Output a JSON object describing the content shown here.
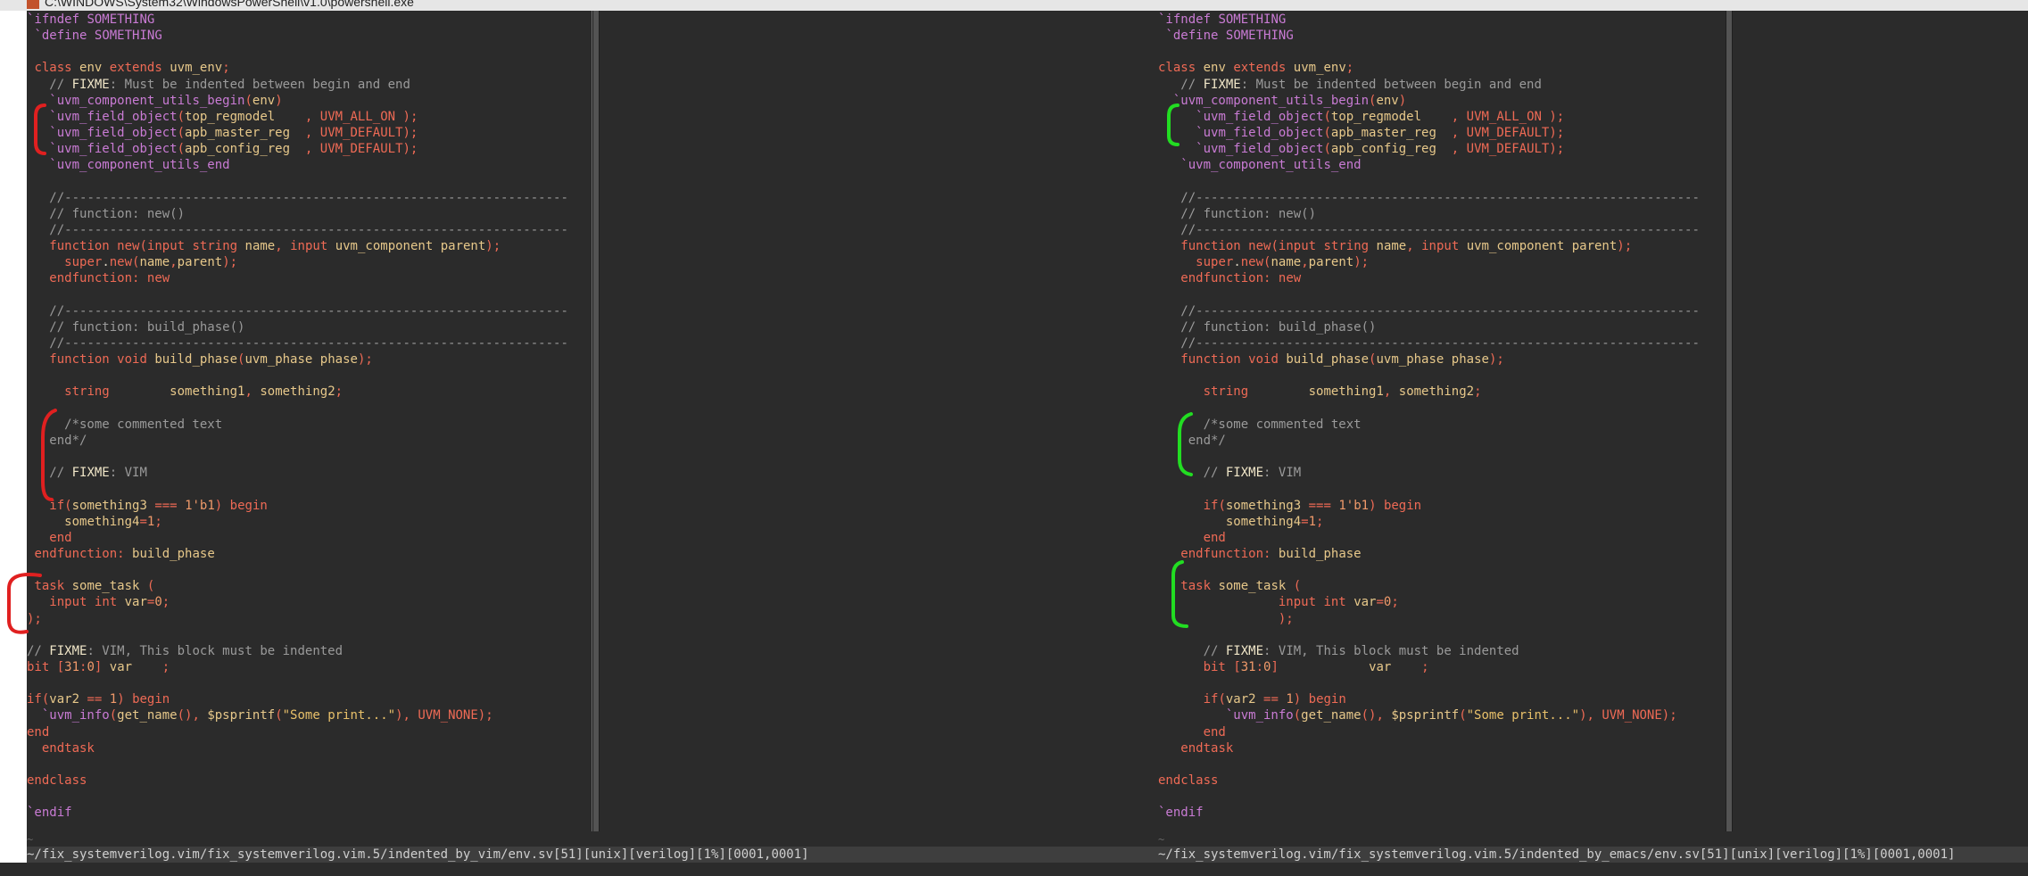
{
  "window": {
    "title": "C:\\WINDOWS\\System32\\WindowsPowerShell\\v1.0\\powershell.exe"
  },
  "colors": {
    "background": "#2b2b2b",
    "status_bar": "#3e3e3e",
    "keyword": "#ee6a55",
    "preprocessor": "#c97bd4",
    "comment": "#9a9a9a",
    "string": "#e8c06a",
    "bracket_left": "#e02020",
    "bracket_right": "#22dd22"
  },
  "left_pane": {
    "status": "~/fix_systemverilog.vim/fix_systemverilog.vim.5/indented_by_vim/env.sv[51][unix][verilog][1%][0001,0001]",
    "lines": [
      {
        "i": 0,
        "t": "`ifndef SOMETHING"
      },
      {
        "i": 1,
        "t": " `define SOMETHING"
      },
      {
        "i": 2,
        "t": ""
      },
      {
        "i": 3,
        "t": " class env extends uvm_env;"
      },
      {
        "i": 4,
        "t": "   // FIXME: Must be indented between begin and end"
      },
      {
        "i": 5,
        "t": "   `uvm_component_utils_begin(env)"
      },
      {
        "i": 6,
        "t": "   `uvm_field_object(top_regmodel    , UVM_ALL_ON );"
      },
      {
        "i": 7,
        "t": "   `uvm_field_object(apb_master_reg  , UVM_DEFAULT);"
      },
      {
        "i": 8,
        "t": "   `uvm_field_object(apb_config_reg  , UVM_DEFAULT);"
      },
      {
        "i": 9,
        "t": "   `uvm_component_utils_end"
      },
      {
        "i": 10,
        "t": ""
      },
      {
        "i": 11,
        "t": "   //-------------------------------------------------------------------"
      },
      {
        "i": 12,
        "t": "   // function: new()"
      },
      {
        "i": 13,
        "t": "   //-------------------------------------------------------------------"
      },
      {
        "i": 14,
        "t": "   function new(input string name, input uvm_component parent);"
      },
      {
        "i": 15,
        "t": "     super.new(name,parent);"
      },
      {
        "i": 16,
        "t": "   endfunction: new"
      },
      {
        "i": 17,
        "t": ""
      },
      {
        "i": 18,
        "t": "   //-------------------------------------------------------------------"
      },
      {
        "i": 19,
        "t": "   // function: build_phase()"
      },
      {
        "i": 20,
        "t": "   //-------------------------------------------------------------------"
      },
      {
        "i": 21,
        "t": "   function void build_phase(uvm_phase phase);"
      },
      {
        "i": 22,
        "t": ""
      },
      {
        "i": 23,
        "t": "     string        something1, something2;"
      },
      {
        "i": 24,
        "t": ""
      },
      {
        "i": 25,
        "t": "     /*some commented text"
      },
      {
        "i": 26,
        "t": "   end*/"
      },
      {
        "i": 27,
        "t": ""
      },
      {
        "i": 28,
        "t": "   // FIXME: VIM"
      },
      {
        "i": 29,
        "t": ""
      },
      {
        "i": 30,
        "t": "   if(something3 === 1'b1) begin"
      },
      {
        "i": 31,
        "t": "     something4=1;"
      },
      {
        "i": 32,
        "t": "   end"
      },
      {
        "i": 33,
        "t": " endfunction: build_phase"
      },
      {
        "i": 34,
        "t": ""
      },
      {
        "i": 35,
        "t": " task some_task ("
      },
      {
        "i": 36,
        "t": "   input int var=0;"
      },
      {
        "i": 37,
        "t": ");"
      },
      {
        "i": 38,
        "t": ""
      },
      {
        "i": 39,
        "t": "// FIXME: VIM, This block must be indented"
      },
      {
        "i": 40,
        "t": "bit [31:0] var    ;"
      },
      {
        "i": 41,
        "t": ""
      },
      {
        "i": 42,
        "t": "if(var2 == 1) begin"
      },
      {
        "i": 43,
        "t": "  `uvm_info(get_name(), $psprintf(\"Some print...\"), UVM_NONE);"
      },
      {
        "i": 44,
        "t": "end"
      },
      {
        "i": 45,
        "t": "  endtask"
      },
      {
        "i": 46,
        "t": ""
      },
      {
        "i": 47,
        "t": "endclass"
      },
      {
        "i": 48,
        "t": ""
      },
      {
        "i": 49,
        "t": "`endif"
      }
    ]
  },
  "right_pane": {
    "status": "~/fix_systemverilog.vim/fix_systemverilog.vim.5/indented_by_emacs/env.sv[51][unix][verilog][1%][0001,0001]",
    "lines": [
      {
        "i": 0,
        "t": "`ifndef SOMETHING"
      },
      {
        "i": 1,
        "t": " `define SOMETHING"
      },
      {
        "i": 2,
        "t": ""
      },
      {
        "i": 3,
        "t": "class env extends uvm_env;"
      },
      {
        "i": 4,
        "t": "   // FIXME: Must be indented between begin and end"
      },
      {
        "i": 5,
        "t": "  `uvm_component_utils_begin(env)"
      },
      {
        "i": 6,
        "t": "     `uvm_field_object(top_regmodel    , UVM_ALL_ON );"
      },
      {
        "i": 7,
        "t": "     `uvm_field_object(apb_master_reg  , UVM_DEFAULT);"
      },
      {
        "i": 8,
        "t": "     `uvm_field_object(apb_config_reg  , UVM_DEFAULT);"
      },
      {
        "i": 9,
        "t": "   `uvm_component_utils_end"
      },
      {
        "i": 10,
        "t": ""
      },
      {
        "i": 11,
        "t": "   //-------------------------------------------------------------------"
      },
      {
        "i": 12,
        "t": "   // function: new()"
      },
      {
        "i": 13,
        "t": "   //-------------------------------------------------------------------"
      },
      {
        "i": 14,
        "t": "   function new(input string name, input uvm_component parent);"
      },
      {
        "i": 15,
        "t": "     super.new(name,parent);"
      },
      {
        "i": 16,
        "t": "   endfunction: new"
      },
      {
        "i": 17,
        "t": ""
      },
      {
        "i": 18,
        "t": "   //-------------------------------------------------------------------"
      },
      {
        "i": 19,
        "t": "   // function: build_phase()"
      },
      {
        "i": 20,
        "t": "   //-------------------------------------------------------------------"
      },
      {
        "i": 21,
        "t": "   function void build_phase(uvm_phase phase);"
      },
      {
        "i": 22,
        "t": ""
      },
      {
        "i": 23,
        "t": "      string        something1, something2;"
      },
      {
        "i": 24,
        "t": ""
      },
      {
        "i": 25,
        "t": "      /*some commented text"
      },
      {
        "i": 26,
        "t": "    end*/"
      },
      {
        "i": 27,
        "t": ""
      },
      {
        "i": 28,
        "t": "      // FIXME: VIM"
      },
      {
        "i": 29,
        "t": ""
      },
      {
        "i": 30,
        "t": "      if(something3 === 1'b1) begin"
      },
      {
        "i": 31,
        "t": "         something4=1;"
      },
      {
        "i": 32,
        "t": "      end"
      },
      {
        "i": 33,
        "t": "   endfunction: build_phase"
      },
      {
        "i": 34,
        "t": ""
      },
      {
        "i": 35,
        "t": "   task some_task ("
      },
      {
        "i": 36,
        "t": "                input int var=0;"
      },
      {
        "i": 37,
        "t": "                );"
      },
      {
        "i": 38,
        "t": ""
      },
      {
        "i": 39,
        "t": "      // FIXME: VIM, This block must be indented"
      },
      {
        "i": 40,
        "t": "      bit [31:0]            var    ;"
      },
      {
        "i": 41,
        "t": ""
      },
      {
        "i": 42,
        "t": "      if(var2 == 1) begin"
      },
      {
        "i": 43,
        "t": "         `uvm_info(get_name(), $psprintf(\"Some print...\"), UVM_NONE);"
      },
      {
        "i": 44,
        "t": "      end"
      },
      {
        "i": 45,
        "t": "   endtask"
      },
      {
        "i": 46,
        "t": ""
      },
      {
        "i": 47,
        "t": "endclass"
      },
      {
        "i": 48,
        "t": ""
      },
      {
        "i": 49,
        "t": "`endif"
      }
    ]
  }
}
